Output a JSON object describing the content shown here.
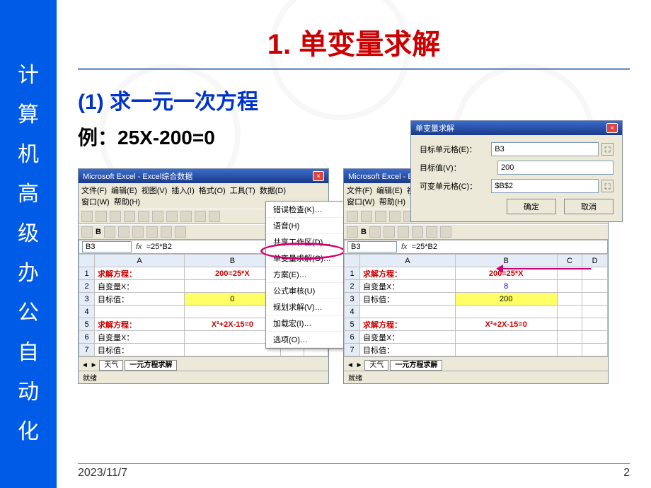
{
  "sidebar_chars": [
    "计",
    "算",
    "机",
    "高",
    "级",
    "办",
    "公",
    "自",
    "动",
    "化"
  ],
  "title": "1. 单变量求解",
  "sub1": "(1) 求一元一次方程",
  "example": "例：25X-200=0",
  "dialog": {
    "title": "单变量求解",
    "row1_label": "目标单元格(E)：",
    "row1_value": "B3",
    "row2_label": "目标值(V)：",
    "row2_value": "200",
    "row3_label": "可变单元格(C)：",
    "row3_value": "$B$2",
    "ok": "确定",
    "cancel": "取消"
  },
  "excel_title": "Microsoft Excel - Excel综合数据",
  "menus": {
    "file": "文件(F)",
    "edit": "编辑(E)",
    "view": "视图(V)",
    "insert": "插入(I)",
    "format": "格式(O)",
    "tools": "工具(T)",
    "data": "数据(D)",
    "window": "窗口(W)",
    "help": "帮助(H)"
  },
  "cellname": "B3",
  "formula": "=25*B2",
  "cols": [
    "A",
    "B",
    "C",
    "D"
  ],
  "grid1": [
    {
      "n": "1",
      "a": "求解方程：",
      "b": "200=25*X",
      "ared": true,
      "bcenter": true,
      "bred": true
    },
    {
      "n": "2",
      "a": "自变量X：",
      "b": ""
    },
    {
      "n": "3",
      "a": "目标值：",
      "b": "0",
      "bcenter": true,
      "byellow": true,
      "bsel": true
    },
    {
      "n": "4",
      "a": "",
      "b": ""
    },
    {
      "n": "5",
      "a": "求解方程：",
      "b": "X²+2X-15=0",
      "ared": true,
      "bcenter": true,
      "bred": true
    },
    {
      "n": "6",
      "a": "自变量X：",
      "b": ""
    },
    {
      "n": "7",
      "a": "目标值：",
      "b": ""
    }
  ],
  "grid2": [
    {
      "n": "1",
      "a": "求解方程：",
      "b": "200=25*X",
      "ared": true,
      "bcenter": true,
      "bred": true
    },
    {
      "n": "2",
      "a": "自变量X：",
      "b": "8",
      "bcenter": true,
      "bblue": true
    },
    {
      "n": "3",
      "a": "目标值：",
      "b": "200",
      "bcenter": true,
      "byellow": true,
      "bsel": true
    },
    {
      "n": "4",
      "a": "",
      "b": ""
    },
    {
      "n": "5",
      "a": "求解方程：",
      "b": "X²+2X-15=0",
      "ared": true,
      "bcenter": true,
      "bred": true
    },
    {
      "n": "6",
      "a": "自变量X：",
      "b": ""
    },
    {
      "n": "7",
      "a": "目标值：",
      "b": ""
    }
  ],
  "dropdown": [
    "错误检查(K)…",
    "语音(H)",
    "共享工作区(D)…",
    "单变量求解(G)…",
    "方案(E)…",
    "公式审核(U)",
    "规划求解(V)…",
    "加载宏(I)…",
    "选项(O)…"
  ],
  "sheet_left": "天气",
  "sheet_active": "一元方程求解",
  "status": "就绪",
  "footer_date": "2023/11/7",
  "footer_page": "2"
}
